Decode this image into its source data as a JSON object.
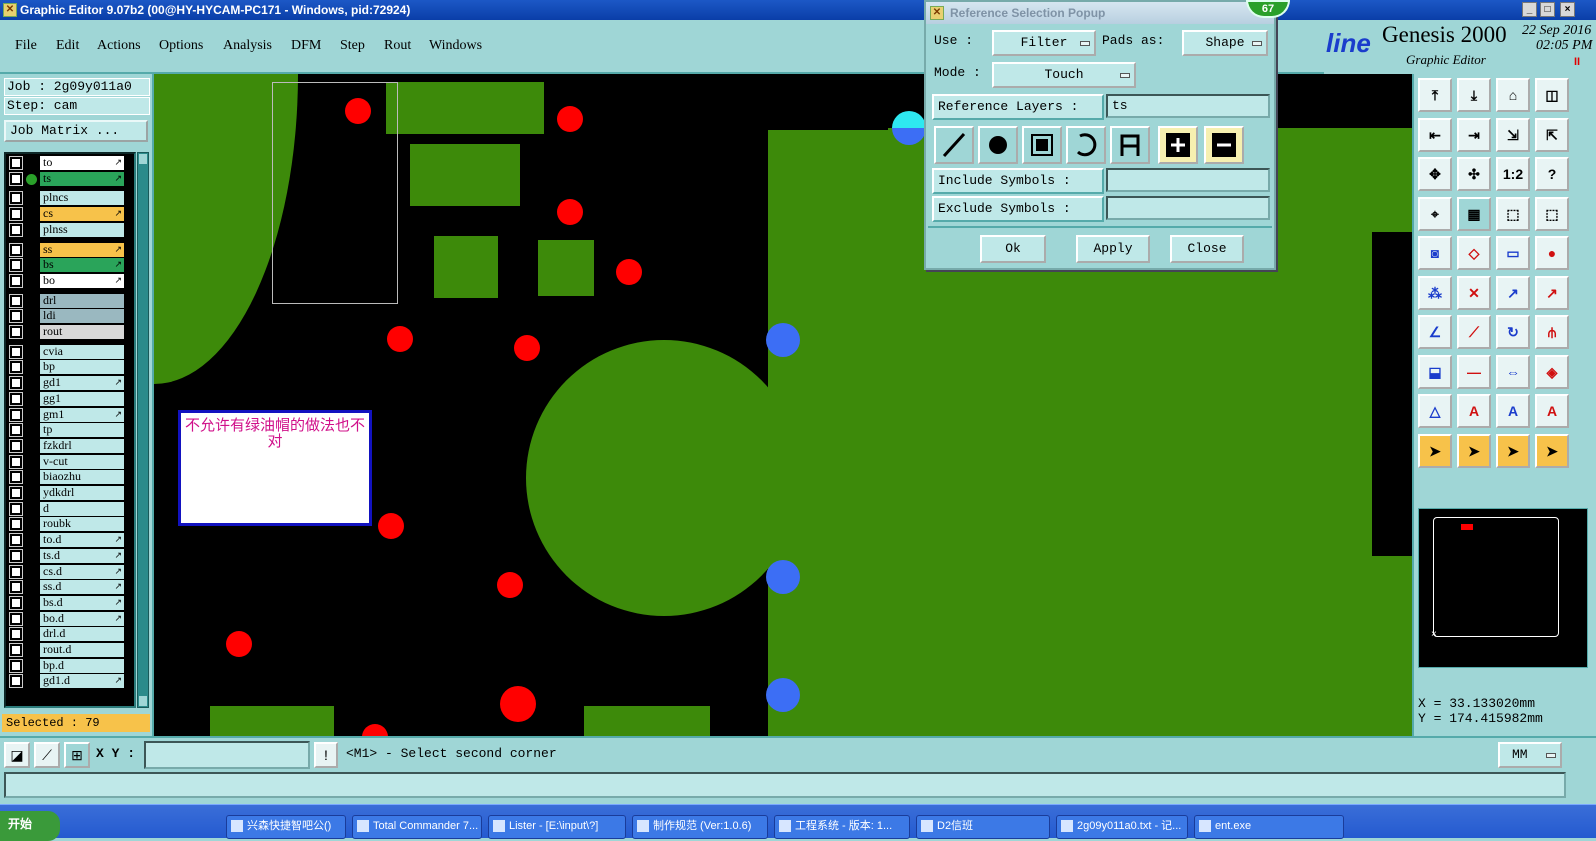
{
  "window": {
    "title": "Graphic Editor 9.07b2 (00@HY-HYCAM-PC171 - Windows, pid:72924)",
    "controls": [
      "_",
      "□",
      "×"
    ]
  },
  "menu": {
    "items": [
      "File",
      "Edit",
      "Actions",
      "Options",
      "Analysis",
      "DFM",
      "Step",
      "Rout",
      "Windows"
    ]
  },
  "brand": {
    "partial_logo": "line",
    "product": "Genesis 2000",
    "subtitle": "Graphic Editor",
    "date": "22 Sep 2016",
    "time": "02:05 PM",
    "pause_icon": "II"
  },
  "job": {
    "job_label": "Job : 2g09y011a0",
    "step_label": "Step: cam",
    "job_matrix_button": "Job Matrix ..."
  },
  "layers": [
    {
      "name": "to",
      "color": "#ffffff",
      "flag": "↗"
    },
    {
      "name": "ts",
      "color": "#2aa45a",
      "flag": "↗",
      "active": true
    },
    {
      "name": "plncs",
      "color": "#bfe8e8",
      "flag": ""
    },
    {
      "name": "cs",
      "color": "#f7c24a",
      "flag": "↗"
    },
    {
      "name": "plnss",
      "color": "#bfe8e8",
      "flag": ""
    },
    {
      "name": "ss",
      "color": "#f7c24a",
      "flag": "↗"
    },
    {
      "name": "bs",
      "color": "#2aa45a",
      "flag": "↗"
    },
    {
      "name": "bo",
      "color": "#ffffff",
      "flag": "↗"
    },
    {
      "name": "drl",
      "color": "#9ab8c0",
      "flag": ""
    },
    {
      "name": "ldi",
      "color": "#9ab8c0",
      "flag": ""
    },
    {
      "name": "rout",
      "color": "#d8d8d8",
      "flag": ""
    },
    {
      "name": "cvia",
      "color": "#bfe8e8",
      "flag": ""
    },
    {
      "name": "bp",
      "color": "#bfe8e8",
      "flag": ""
    },
    {
      "name": "gd1",
      "color": "#bfe8e8",
      "flag": "↗"
    },
    {
      "name": "gg1",
      "color": "#bfe8e8",
      "flag": ""
    },
    {
      "name": "gm1",
      "color": "#bfe8e8",
      "flag": "↗"
    },
    {
      "name": "tp",
      "color": "#bfe8e8",
      "flag": ""
    },
    {
      "name": "fzkdrl",
      "color": "#bfe8e8",
      "flag": ""
    },
    {
      "name": "v-cut",
      "color": "#bfe8e8",
      "flag": ""
    },
    {
      "name": "biaozhu",
      "color": "#bfe8e8",
      "flag": ""
    },
    {
      "name": "ydkdrl",
      "color": "#bfe8e8",
      "flag": ""
    },
    {
      "name": "d",
      "color": "#bfe8e8",
      "flag": ""
    },
    {
      "name": "roubk",
      "color": "#bfe8e8",
      "flag": ""
    },
    {
      "name": "to.d",
      "color": "#bfe8e8",
      "flag": "↗"
    },
    {
      "name": "ts.d",
      "color": "#bfe8e8",
      "flag": "↗"
    },
    {
      "name": "cs.d",
      "color": "#bfe8e8",
      "flag": "↗"
    },
    {
      "name": "ss.d",
      "color": "#bfe8e8",
      "flag": "↗"
    },
    {
      "name": "bs.d",
      "color": "#bfe8e8",
      "flag": "↗"
    },
    {
      "name": "bo.d",
      "color": "#bfe8e8",
      "flag": "↗"
    },
    {
      "name": "drl.d",
      "color": "#bfe8e8",
      "flag": ""
    },
    {
      "name": "rout.d",
      "color": "#bfe8e8",
      "flag": ""
    },
    {
      "name": "bp.d",
      "color": "#bfe8e8",
      "flag": ""
    },
    {
      "name": "gd1.d",
      "color": "#bfe8e8",
      "flag": "↗"
    }
  ],
  "selected": "Selected : 79",
  "note": "不允许有绿油帽的做法也不对",
  "popup": {
    "title": "Reference Selection Popup",
    "badge": "67",
    "use_label": "Use   :",
    "use_value": "Filter",
    "pads_as_label": "Pads as:",
    "pads_as_value": "Shape",
    "mode_label": "Mode  :",
    "mode_value": "Touch",
    "ref_layers_label": "Reference Layers :",
    "ref_layers_value": "ts",
    "include_label": "Include Symbols :",
    "include_value": "",
    "exclude_label": "Exclude Symbols :",
    "exclude_value": "",
    "ok": "Ok",
    "apply": "Apply",
    "close": "Close"
  },
  "coords": {
    "x": "X  =  33.133020mm",
    "y": "Y  = 174.415982mm"
  },
  "bottom": {
    "xy_label": "X Y :",
    "xy_value": "",
    "status": "<M1> - Select second corner",
    "units": "MM"
  },
  "taskbar": {
    "start": "开始",
    "tasks": [
      "兴森快捷智吧公()",
      "Total Commander 7...",
      "Lister - [E:\\input\\?]",
      "制作规范 (Ver:1.0.6)",
      "工程系统 - 版本: 1...",
      "D2信班",
      "2g09y011a0.txt - 记...",
      "ent.exe"
    ]
  },
  "colors": {
    "copper_green": "#3d8a0a",
    "pad_red": "#ff0000",
    "via_blue": "#3c6ef5",
    "panel_teal": "#9fd6d6"
  }
}
